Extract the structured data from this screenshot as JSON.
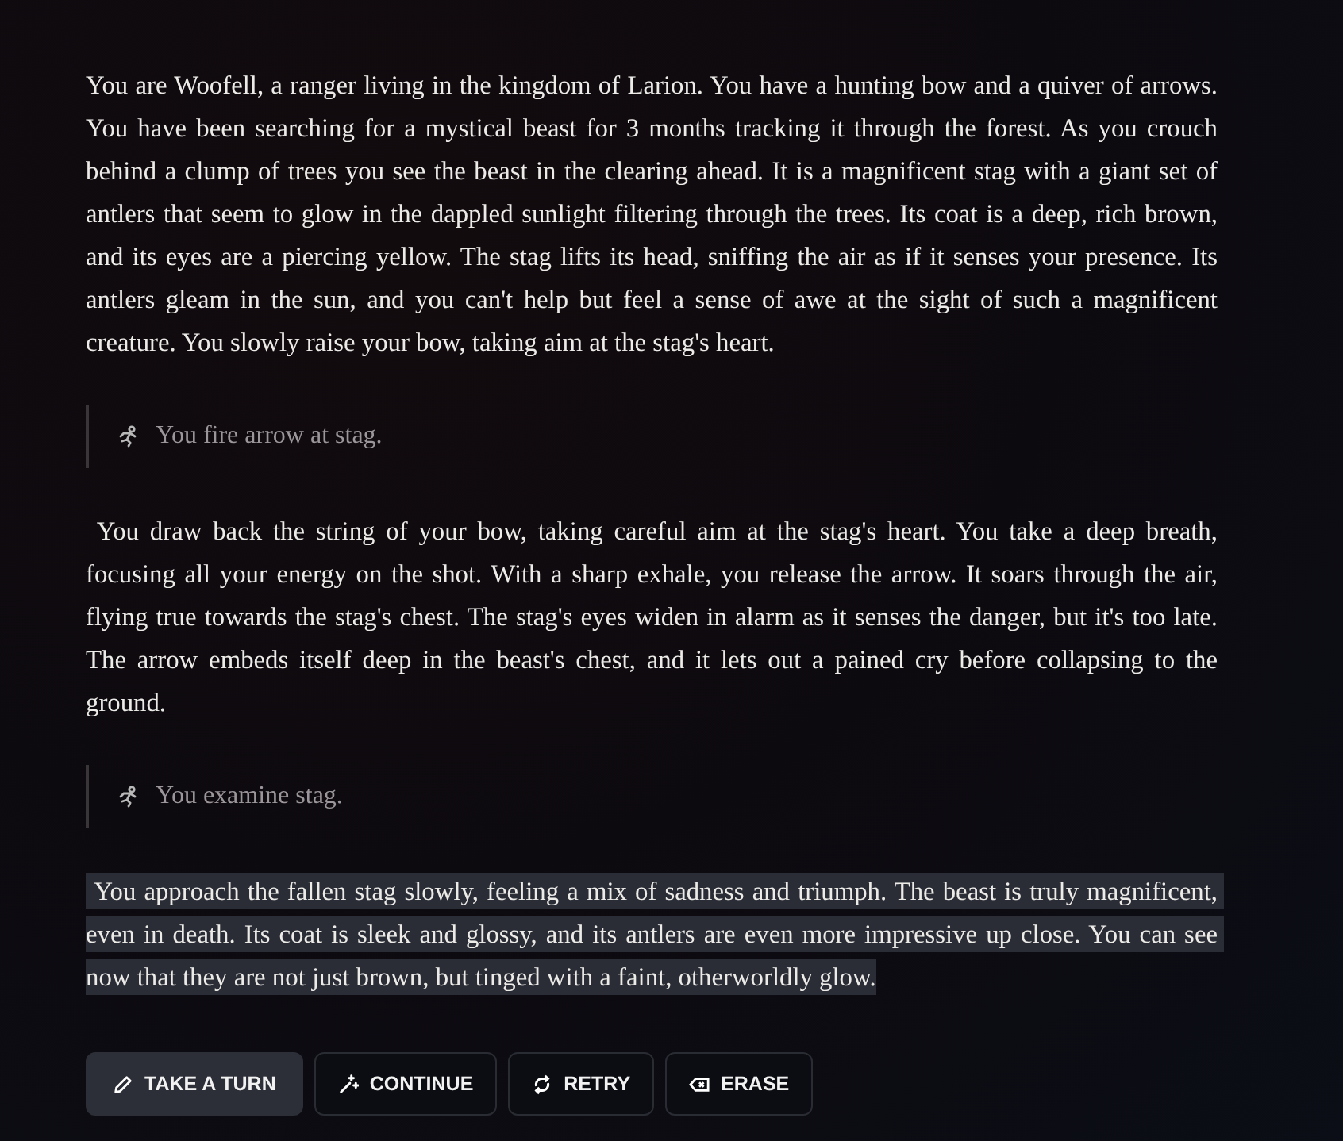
{
  "story": [
    {
      "kind": "story",
      "highlighted": false,
      "text": "You are Woofell, a ranger living in the kingdom of Larion. You have a hunting bow and a quiver of arrows. You have been searching for a mystical beast for 3 months tracking it through the forest. As you crouch behind a clump of trees you see the beast in the clearing ahead. It is a magnificent stag with a giant set of antlers that seem to glow in the dappled sunlight filtering through the trees. Its coat is a deep, rich brown, and its eyes are a piercing yellow. The stag lifts its head, sniffing the air as if it senses your presence. Its antlers gleam in the sun, and you can't help but feel a sense of awe at the sight of such a magnificent creature. You slowly raise your bow, taking aim at the stag's heart."
    },
    {
      "kind": "action",
      "text": "You fire arrow at stag."
    },
    {
      "kind": "story",
      "highlighted": false,
      "text": " You draw back the string of your bow, taking careful aim at the stag's heart. You take a deep breath, focusing all your energy on the shot. With a sharp exhale, you release the arrow. It soars through the air, flying true towards the stag's chest. The stag's eyes widen in alarm as it senses the danger, but it's too late. The arrow embeds itself deep in the beast's chest, and it lets out a pained cry before collapsing to the ground."
    },
    {
      "kind": "action",
      "text": "You examine stag."
    },
    {
      "kind": "story",
      "highlighted": true,
      "text": " You approach the fallen stag slowly, feeling a mix of sadness and triumph. The beast is truly magnificent, even in death. Its coat is sleek and glossy, and its antlers are even more impressive up close. You can see now that they are not just brown, but tinged with a faint, otherworldly glow."
    }
  ],
  "buttons": [
    {
      "kind": "pencil",
      "label": "TAKE A TURN",
      "selected": true
    },
    {
      "kind": "wand",
      "label": "CONTINUE",
      "selected": false
    },
    {
      "kind": "retry",
      "label": "RETRY",
      "selected": false
    },
    {
      "kind": "erase",
      "label": "ERASE",
      "selected": false
    }
  ]
}
